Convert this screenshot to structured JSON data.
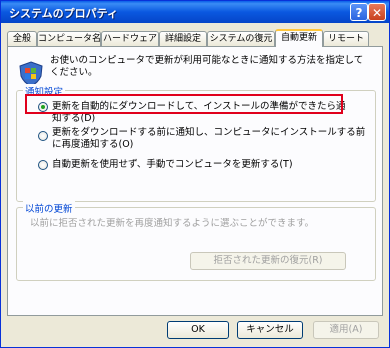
{
  "window": {
    "title": "システムのプロパティ",
    "help_symbol": "?",
    "close_symbol": "✕"
  },
  "tabs": [
    {
      "label": "全般"
    },
    {
      "label": "コンピュータ名"
    },
    {
      "label": "ハードウェア"
    },
    {
      "label": "詳細設定"
    },
    {
      "label": "システムの復元"
    },
    {
      "label": "自動更新"
    },
    {
      "label": "リモート"
    }
  ],
  "intro_text": "お使いのコンピュータで更新が利用可能なときに通知する方法を指定してください。",
  "notify_group": {
    "legend": "通知設定",
    "options": [
      {
        "label": "更新を自動的にダウンロードして、インストールの準備ができたら通知する(D)",
        "selected": true
      },
      {
        "label": "更新をダウンロードする前に通知し、コンピュータにインストールする前に再度通知する(O)",
        "selected": false
      },
      {
        "label": "自動更新を使用せず、手動でコンピュータを更新する(T)",
        "selected": false
      }
    ]
  },
  "previous_group": {
    "legend": "以前の更新",
    "description": "以前に拒否された更新を再度通知するように選ぶことができます。",
    "restore_button": "拒否された更新の復元(R)"
  },
  "buttons": {
    "ok": "OK",
    "cancel": "キャンセル",
    "apply": "適用(A)"
  },
  "colors": {
    "titlebar": "#0a58e0",
    "highlight_box": "#e0001c",
    "active_tab_accent": "#ffc73c"
  }
}
